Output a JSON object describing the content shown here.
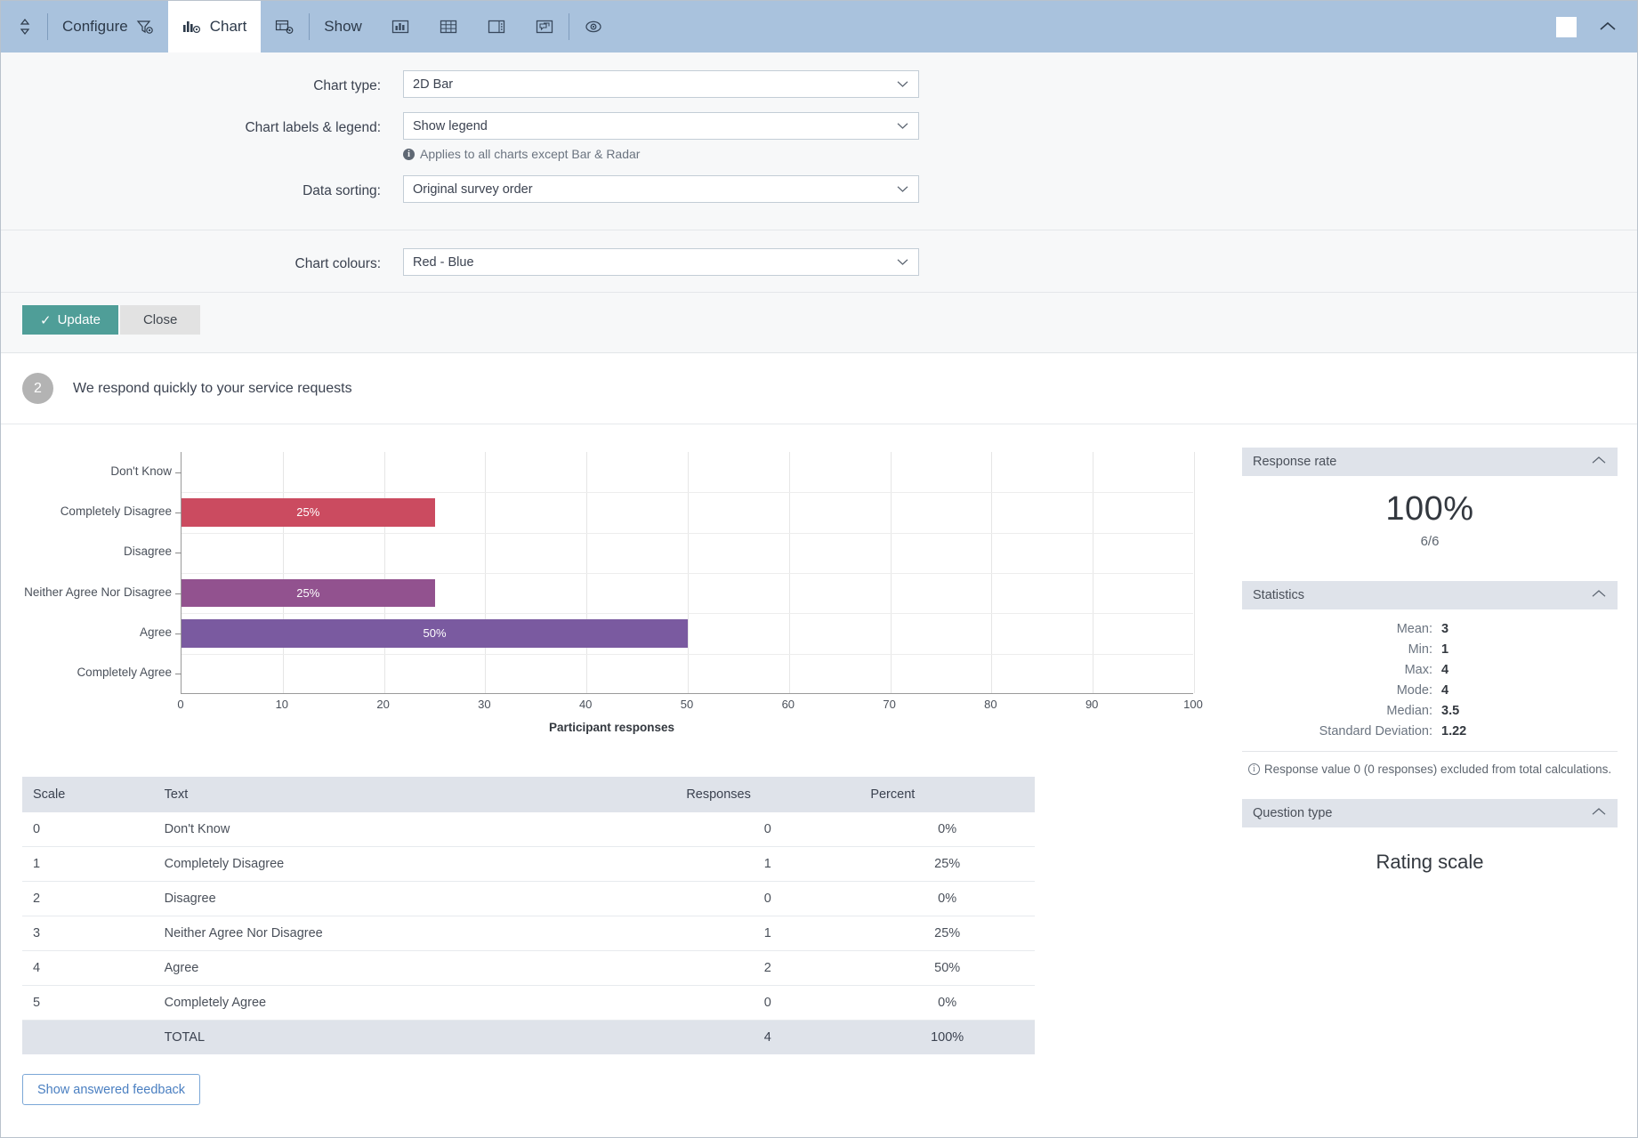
{
  "toolbar": {
    "resize_icon": "updown-arrow-icon",
    "configure_label": "Configure",
    "configure_icon": "filter-gear-icon",
    "chart_label": "Chart",
    "chart_icon": "bar-chart-gear-icon",
    "layout_icon": "layout-gear-icon",
    "show_label": "Show",
    "show_chart_icon": "bar-chart-icon",
    "show_table_icon": "table-grid-icon",
    "show_panel_icon": "side-panel-icon",
    "show_comments_icon": "comments-icon",
    "preview_icon": "eye-icon",
    "window_box_icon": "window-box-icon",
    "collapse_icon": "chevron-up-icon"
  },
  "config": {
    "chart_type_label": "Chart type:",
    "chart_type_value": "2D Bar",
    "labels_legend_label": "Chart labels & legend:",
    "labels_legend_value": "Show legend",
    "labels_legend_hint": "Applies to all charts except Bar & Radar",
    "data_sorting_label": "Data sorting:",
    "data_sorting_value": "Original survey order",
    "chart_colours_label": "Chart colours:",
    "chart_colours_value": "Red - Blue",
    "update_label": "Update",
    "update_check": "✓",
    "close_label": "Close"
  },
  "question": {
    "number": "2",
    "text": "We respond quickly to your service requests"
  },
  "chart_data": {
    "type": "bar",
    "orientation": "horizontal",
    "title": "",
    "xlabel": "Participant responses",
    "ylabel": "",
    "xlim": [
      0,
      100
    ],
    "xticks": [
      "0",
      "10",
      "20",
      "30",
      "40",
      "50",
      "60",
      "70",
      "80",
      "90",
      "100"
    ],
    "grid": true,
    "legend": false,
    "categories": [
      "Don't Know",
      "Completely Disagree",
      "Disagree",
      "Neither Agree Nor Disagree",
      "Agree",
      "Completely Agree"
    ],
    "values": [
      0,
      25,
      0,
      25,
      50,
      0
    ],
    "value_labels": [
      "",
      "25%",
      "",
      "25%",
      "50%",
      ""
    ],
    "colors": [
      "#cb4b60",
      "#cb4b60",
      "#b04a72",
      "#92528f",
      "#7a5aa0",
      "#6560ac"
    ]
  },
  "table": {
    "headers": [
      "Scale",
      "Text",
      "Responses",
      "Percent"
    ],
    "rows": [
      {
        "scale": "0",
        "text": "Don't Know",
        "responses": "0",
        "percent": "0%"
      },
      {
        "scale": "1",
        "text": "Completely Disagree",
        "responses": "1",
        "percent": "25%"
      },
      {
        "scale": "2",
        "text": "Disagree",
        "responses": "0",
        "percent": "0%"
      },
      {
        "scale": "3",
        "text": "Neither Agree Nor Disagree",
        "responses": "1",
        "percent": "25%"
      },
      {
        "scale": "4",
        "text": "Agree",
        "responses": "2",
        "percent": "50%"
      },
      {
        "scale": "5",
        "text": "Completely Agree",
        "responses": "0",
        "percent": "0%"
      }
    ],
    "total": {
      "scale": "",
      "text": "TOTAL",
      "responses": "4",
      "percent": "100%"
    }
  },
  "feedback_button": "Show answered feedback",
  "panels": {
    "response_rate": {
      "title": "Response rate",
      "value": "100%",
      "sub": "6/6"
    },
    "statistics": {
      "title": "Statistics",
      "items": [
        {
          "label": "Mean:",
          "value": "3"
        },
        {
          "label": "Min:",
          "value": "1"
        },
        {
          "label": "Max:",
          "value": "4"
        },
        {
          "label": "Mode:",
          "value": "4"
        },
        {
          "label": "Median:",
          "value": "3.5"
        },
        {
          "label": "Standard Deviation:",
          "value": "1.22"
        }
      ],
      "note": "Response value 0 (0 responses) excluded from total calculations."
    },
    "question_type": {
      "title": "Question type",
      "value": "Rating scale"
    }
  },
  "colors": {
    "toolbar_bg": "#a9c2dd",
    "accent_teal": "#4f9e98",
    "panel_head": "#dfe3ea",
    "link_blue": "#4a7fc1"
  }
}
